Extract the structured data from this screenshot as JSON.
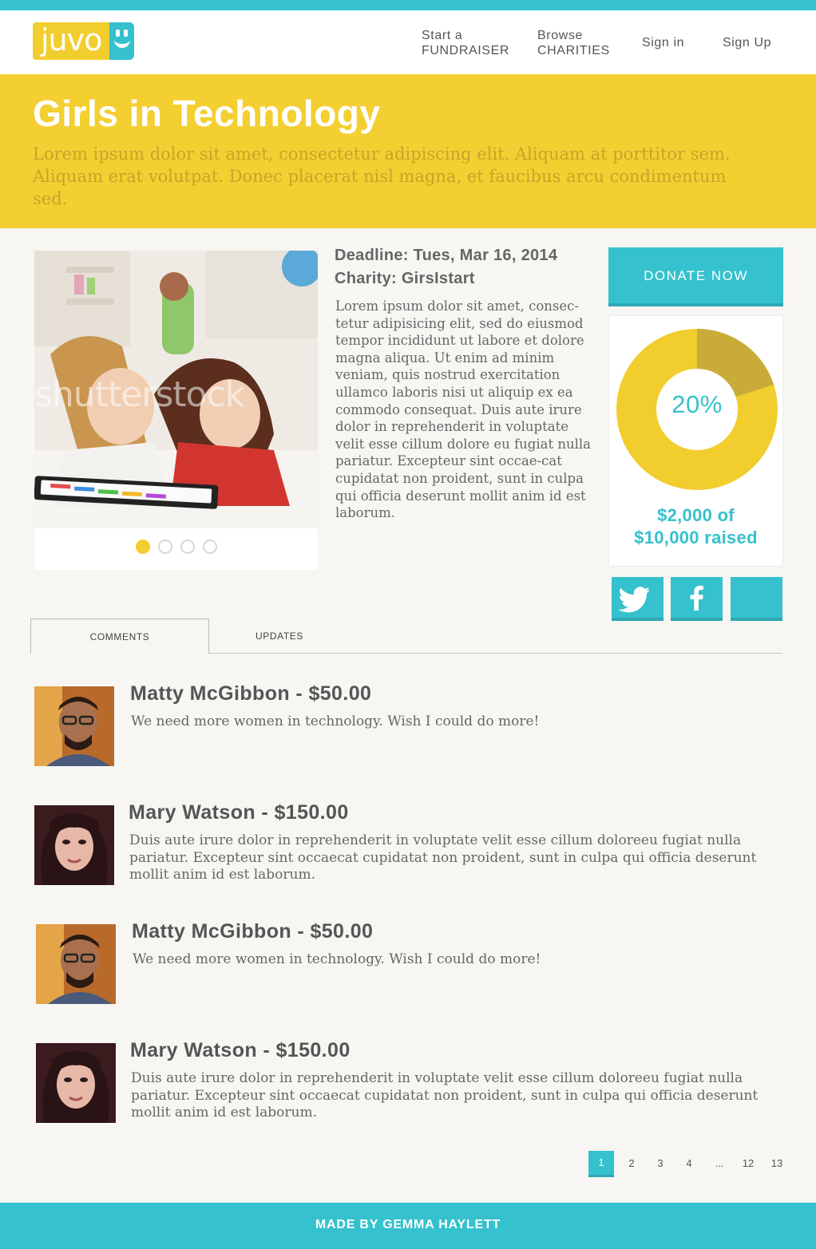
{
  "header": {
    "logo_text": "juvo",
    "nav": [
      {
        "line1": "Start a",
        "line2": "FUNDRAISER"
      },
      {
        "line1": "Browse",
        "line2": "CHARITIES"
      },
      {
        "label": "Sign in"
      },
      {
        "label": "Sign Up"
      }
    ]
  },
  "hero": {
    "title": "Girls in Technology",
    "subtitle": "Lorem ipsum dolor sit amet, consectetur adipiscing elit. Aliquam at porttitor sem. Aliquam erat volutpat. Donec placerat nisl magna, et faucibus arcu condimentum sed."
  },
  "campaign": {
    "deadline": "Deadline: Tues, Mar 16, 2014",
    "charity": "Charity: GirsIstart",
    "description": "Lorem ipsum dolor sit amet, consec-tetur adipisicing elit, sed do eiusmod tempor incididunt ut labore et dolore magna aliqua. Ut enim ad minim veniam, quis nostrud exercitation ullamco laboris nisi ut aliquip ex ea commodo consequat. Duis aute irure dolor in reprehenderit in voluptate velit esse cillum dolore eu fugiat nulla pariatur. Excepteur sint occae-cat cupidatat non proident, sunt in culpa qui officia deserunt mollit anim id est laborum.",
    "carousel": {
      "count": 4,
      "active": 1,
      "watermark": "shutterstock"
    }
  },
  "donation": {
    "button_label": "DONATE NOW",
    "progress_fraction": 0.2,
    "percent_label": "20%",
    "raised_line1": "$2,000 of",
    "raised_line2": "$10,000 raised",
    "colors": {
      "fill": "#c9ab3a",
      "remaining": "#f2cd2e",
      "accent": "#35c1cd"
    }
  },
  "share": [
    {
      "icon": "twitter-icon"
    },
    {
      "icon": "facebook-icon"
    },
    {
      "icon": "share-icon"
    }
  ],
  "tabs": [
    {
      "label": "COMMENTS",
      "active": true
    },
    {
      "label": "UPDATES",
      "active": false
    }
  ],
  "comments": [
    {
      "title": "Matty McGibbon - $50.00",
      "body": "We need more women in technology. Wish I could do more!",
      "avatar": "man"
    },
    {
      "title": "Mary Watson - $150.00",
      "body": "Duis aute irure dolor in reprehenderit in voluptate velit esse cillum doloreeu fugiat nulla pariatur. Excepteur sint occaecat cupidatat non proident, sunt in culpa qui officia deserunt mollit anim id est laborum.",
      "avatar": "woman"
    },
    {
      "title": "Matty McGibbon - $50.00",
      "body": "We need more women in technology. Wish I could do more!",
      "avatar": "man"
    },
    {
      "title": "Mary Watson - $150.00",
      "body": "Duis aute irure dolor in reprehenderit in voluptate velit esse cillum doloreeu fugiat nulla pariatur. Excepteur sint occaecat cupidatat non proident, sunt in culpa qui officia deserunt mollit anim id est laborum.",
      "avatar": "woman"
    }
  ],
  "pagination": {
    "pages": [
      "1",
      "2",
      "3",
      "4",
      "...",
      "12",
      "13"
    ],
    "current": "1"
  },
  "footer": {
    "text": "MADE BY GEMMA HAYLETT"
  }
}
